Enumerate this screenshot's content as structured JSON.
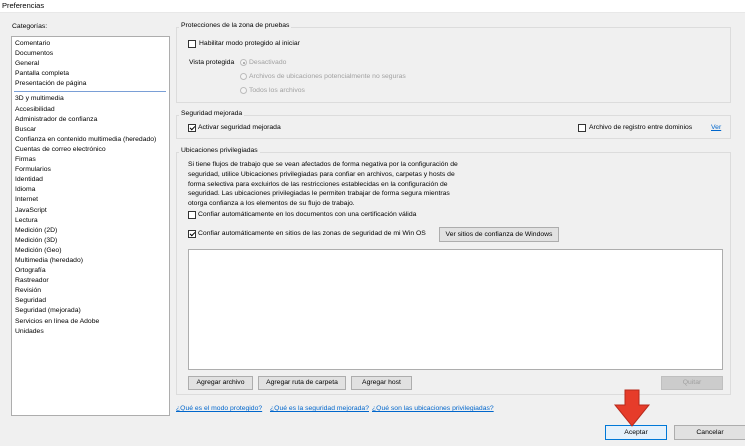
{
  "window": {
    "title": "Preferencias"
  },
  "categories": {
    "label": "Categorías:",
    "group1": [
      "Comentario",
      "Documentos",
      "General",
      "Pantalla completa",
      "Presentación de página"
    ],
    "group2": [
      "3D y multimedia",
      "Accesibilidad",
      "Administrador de confianza",
      "Buscar",
      "Confianza en contenido multimedia (heredado)",
      "Cuentas de correo electrónico",
      "Firmas",
      "Formularios",
      "Identidad",
      "Idioma",
      "Internet",
      "JavaScript",
      "Lectura",
      "Medición (2D)",
      "Medición (3D)",
      "Medición (Geo)",
      "Multimedia (heredado)",
      "Ortografía",
      "Rastreador",
      "Revisión",
      "Seguridad",
      "Seguridad (mejorada)",
      "Servicios en línea de Adobe",
      "Unidades"
    ]
  },
  "sandbox": {
    "title": "Protecciones de la zona de pruebas",
    "protected_mode_label": "Habilitar modo protegido al iniciar",
    "view_protected_label": "Vista protegida",
    "options": [
      "Desactivado",
      "Archivos de ubicaciones potencialmente no seguras",
      "Todos los archivos"
    ]
  },
  "enhanced": {
    "title": "Seguridad mejorada",
    "enable_label": "Activar seguridad mejorada",
    "log_label": "Archivo de registro entre dominios",
    "view_link": "Ver"
  },
  "privileged": {
    "title": "Ubicaciones privilegiadas",
    "description": "Si tiene flujos de trabajo que se vean afectados de forma negativa por la configuración de seguridad, utilice Ubicaciones privilegiadas para confiar en archivos, carpetas y hosts de forma selectiva para excluirlos de las restricciones establecidas en la configuración de seguridad. Las ubicaciones privilegiadas le permiten trabajar de forma segura mientras otorga confianza a los elementos de su flujo de trabajo.",
    "trust_certified_label": "Confiar automáticamente en los documentos con una certificación válida",
    "trust_sites_label": "Confiar automáticamente en sitios de las zonas de seguridad de mi Win OS",
    "view_sites_button": "Ver sitios de confianza de Windows",
    "add_file_button": "Agregar archivo",
    "add_folder_button": "Agregar ruta de carpeta",
    "add_host_button": "Agregar host",
    "remove_button": "Quitar"
  },
  "help_links": [
    "¿Qué es el modo protegido?",
    "¿Qué es la seguridad mejorada?",
    "¿Qué son las ubicaciones privilegiadas?"
  ],
  "footer": {
    "ok_button": "Aceptar",
    "cancel_button": "Cancelar"
  },
  "colors": {
    "accent": "#0078d7",
    "arrow": "#e63c2a",
    "link": "#0066cc"
  }
}
